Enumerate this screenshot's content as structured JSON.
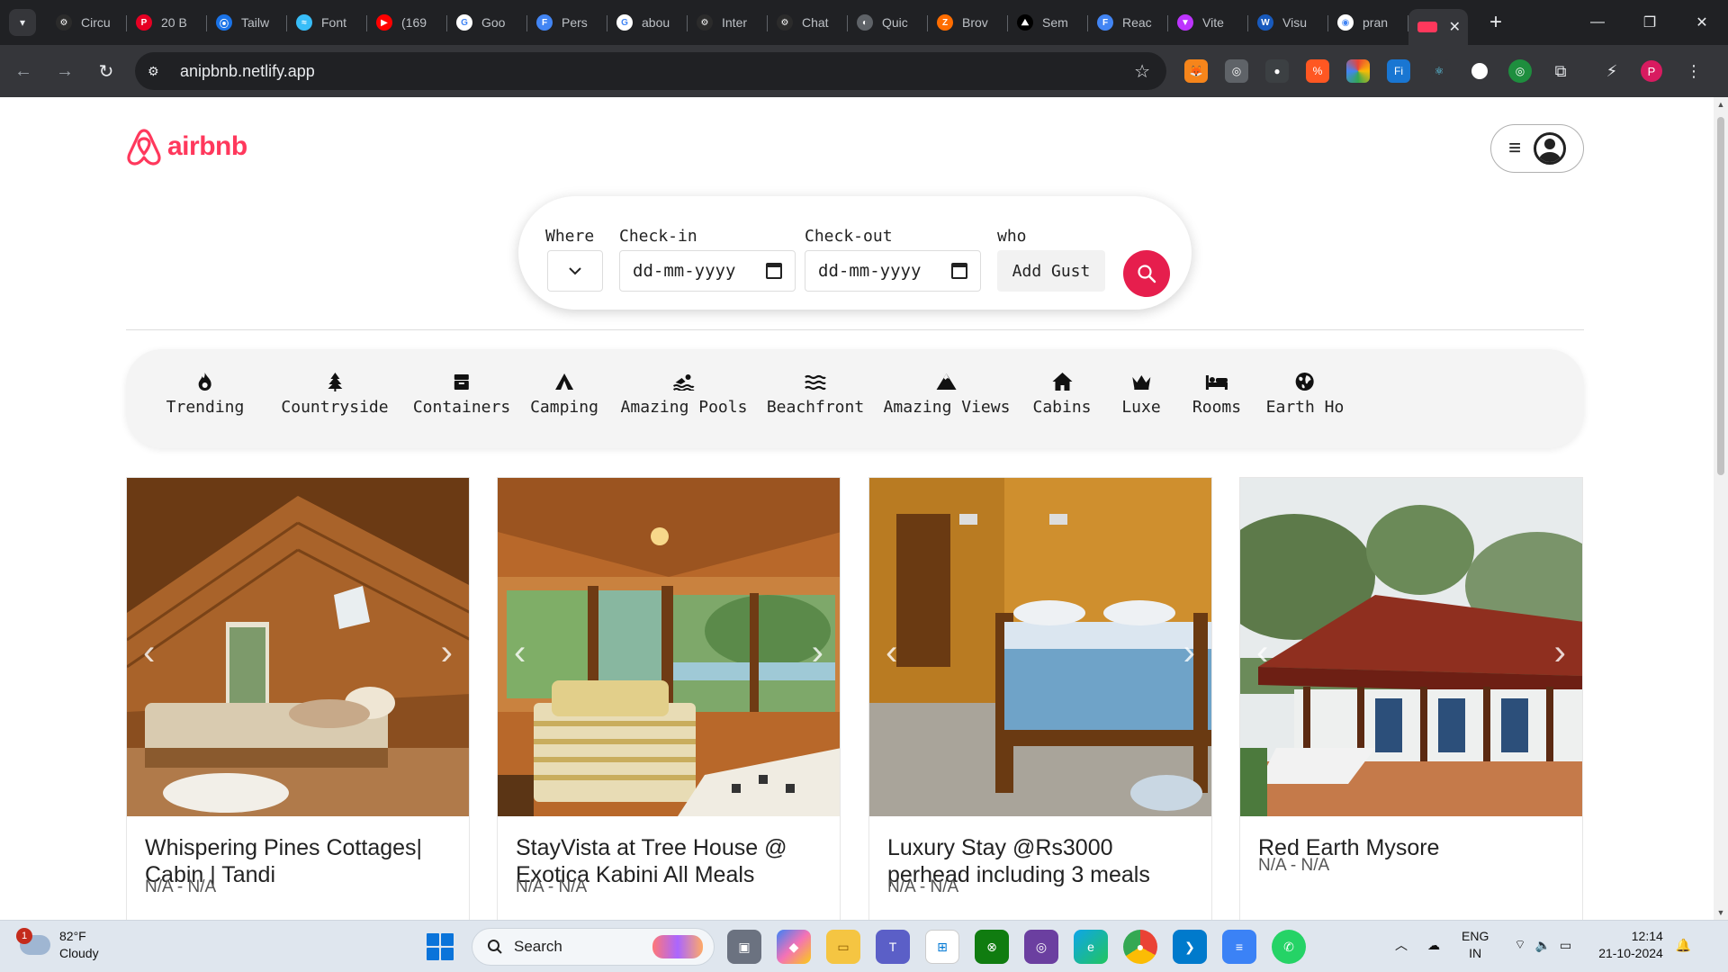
{
  "browser": {
    "tabs": [
      {
        "label": "Circu",
        "color": "#2b2b2b",
        "glyph": "⚙"
      },
      {
        "label": "20 B",
        "color": "#e60023",
        "glyph": "P"
      },
      {
        "label": "Tailw",
        "color": "#1a73e8",
        "glyph": "⦿"
      },
      {
        "label": "Font",
        "color": "#38bdf8",
        "glyph": "≈"
      },
      {
        "label": "(169",
        "color": "#ff0000",
        "glyph": "▶"
      },
      {
        "label": "Goo",
        "color": "#ffffff",
        "glyph": "G"
      },
      {
        "label": "Pers",
        "color": "#4285f4",
        "glyph": "F"
      },
      {
        "label": "abou",
        "color": "#ffffff",
        "glyph": "G"
      },
      {
        "label": "Inter",
        "color": "#2b2b2b",
        "glyph": "⚙"
      },
      {
        "label": "Chat",
        "color": "#2b2b2b",
        "glyph": "⚙"
      },
      {
        "label": "Quic",
        "color": "#5f6368",
        "glyph": "◐"
      },
      {
        "label": "Brov",
        "color": "#ff6d00",
        "glyph": "Z"
      },
      {
        "label": "Sem",
        "color": "#000000",
        "glyph": "⛰"
      },
      {
        "label": "Reac",
        "color": "#4285f4",
        "glyph": "F"
      },
      {
        "label": "Vite",
        "color": "#bd34fe",
        "glyph": "▼"
      },
      {
        "label": "Visu",
        "color": "#185abd",
        "glyph": "W"
      },
      {
        "label": "pran",
        "color": "#ffffff",
        "glyph": "◉"
      }
    ],
    "url": "anipbnb.netlify.app",
    "profile_initial": "P"
  },
  "app": {
    "brand": "airbnb",
    "brand_color": "#ff385c",
    "search": {
      "where_label": "Where",
      "checkin_label": "Check-in",
      "checkout_label": "Check-out",
      "who_label": "who",
      "checkin_value": "dd-mm-yyyy",
      "checkout_value": "dd-mm-yyyy",
      "add_guest": "Add Gust"
    },
    "categories": [
      {
        "label": "Trending",
        "icon": "fire-icon"
      },
      {
        "label": "Countryside",
        "icon": "tree-icon"
      },
      {
        "label": "Containers",
        "icon": "box-icon"
      },
      {
        "label": "Camping",
        "icon": "tent-icon"
      },
      {
        "label": "Amazing Pools",
        "icon": "swimmer-icon"
      },
      {
        "label": "Beachfront",
        "icon": "water-icon"
      },
      {
        "label": "Amazing Views",
        "icon": "mountain-icon"
      },
      {
        "label": "Cabins",
        "icon": "home-icon"
      },
      {
        "label": "Luxe",
        "icon": "crown-icon"
      },
      {
        "label": "Rooms",
        "icon": "bed-icon"
      },
      {
        "label": "Earth Ho",
        "icon": "globe-icon"
      }
    ],
    "listings": [
      {
        "title": "Whispering Pines Cottages| Cabin | Tandi",
        "price": "N/A - N/A"
      },
      {
        "title": "StayVista at Tree House @ Exotica Kabini All Meals",
        "price": "N/A - N/A"
      },
      {
        "title": "Luxury Stay @Rs3000 perhead including 3 meals",
        "price": "N/A - N/A"
      },
      {
        "title": "Red Earth Mysore",
        "price": "N/A - N/A"
      }
    ]
  },
  "taskbar": {
    "weather_temp": "82°F",
    "weather_desc": "Cloudy",
    "weather_badge": "1",
    "search_label": "Search",
    "lang_top": "ENG",
    "lang_bottom": "IN",
    "time": "12:14",
    "date": "21-10-2024"
  }
}
